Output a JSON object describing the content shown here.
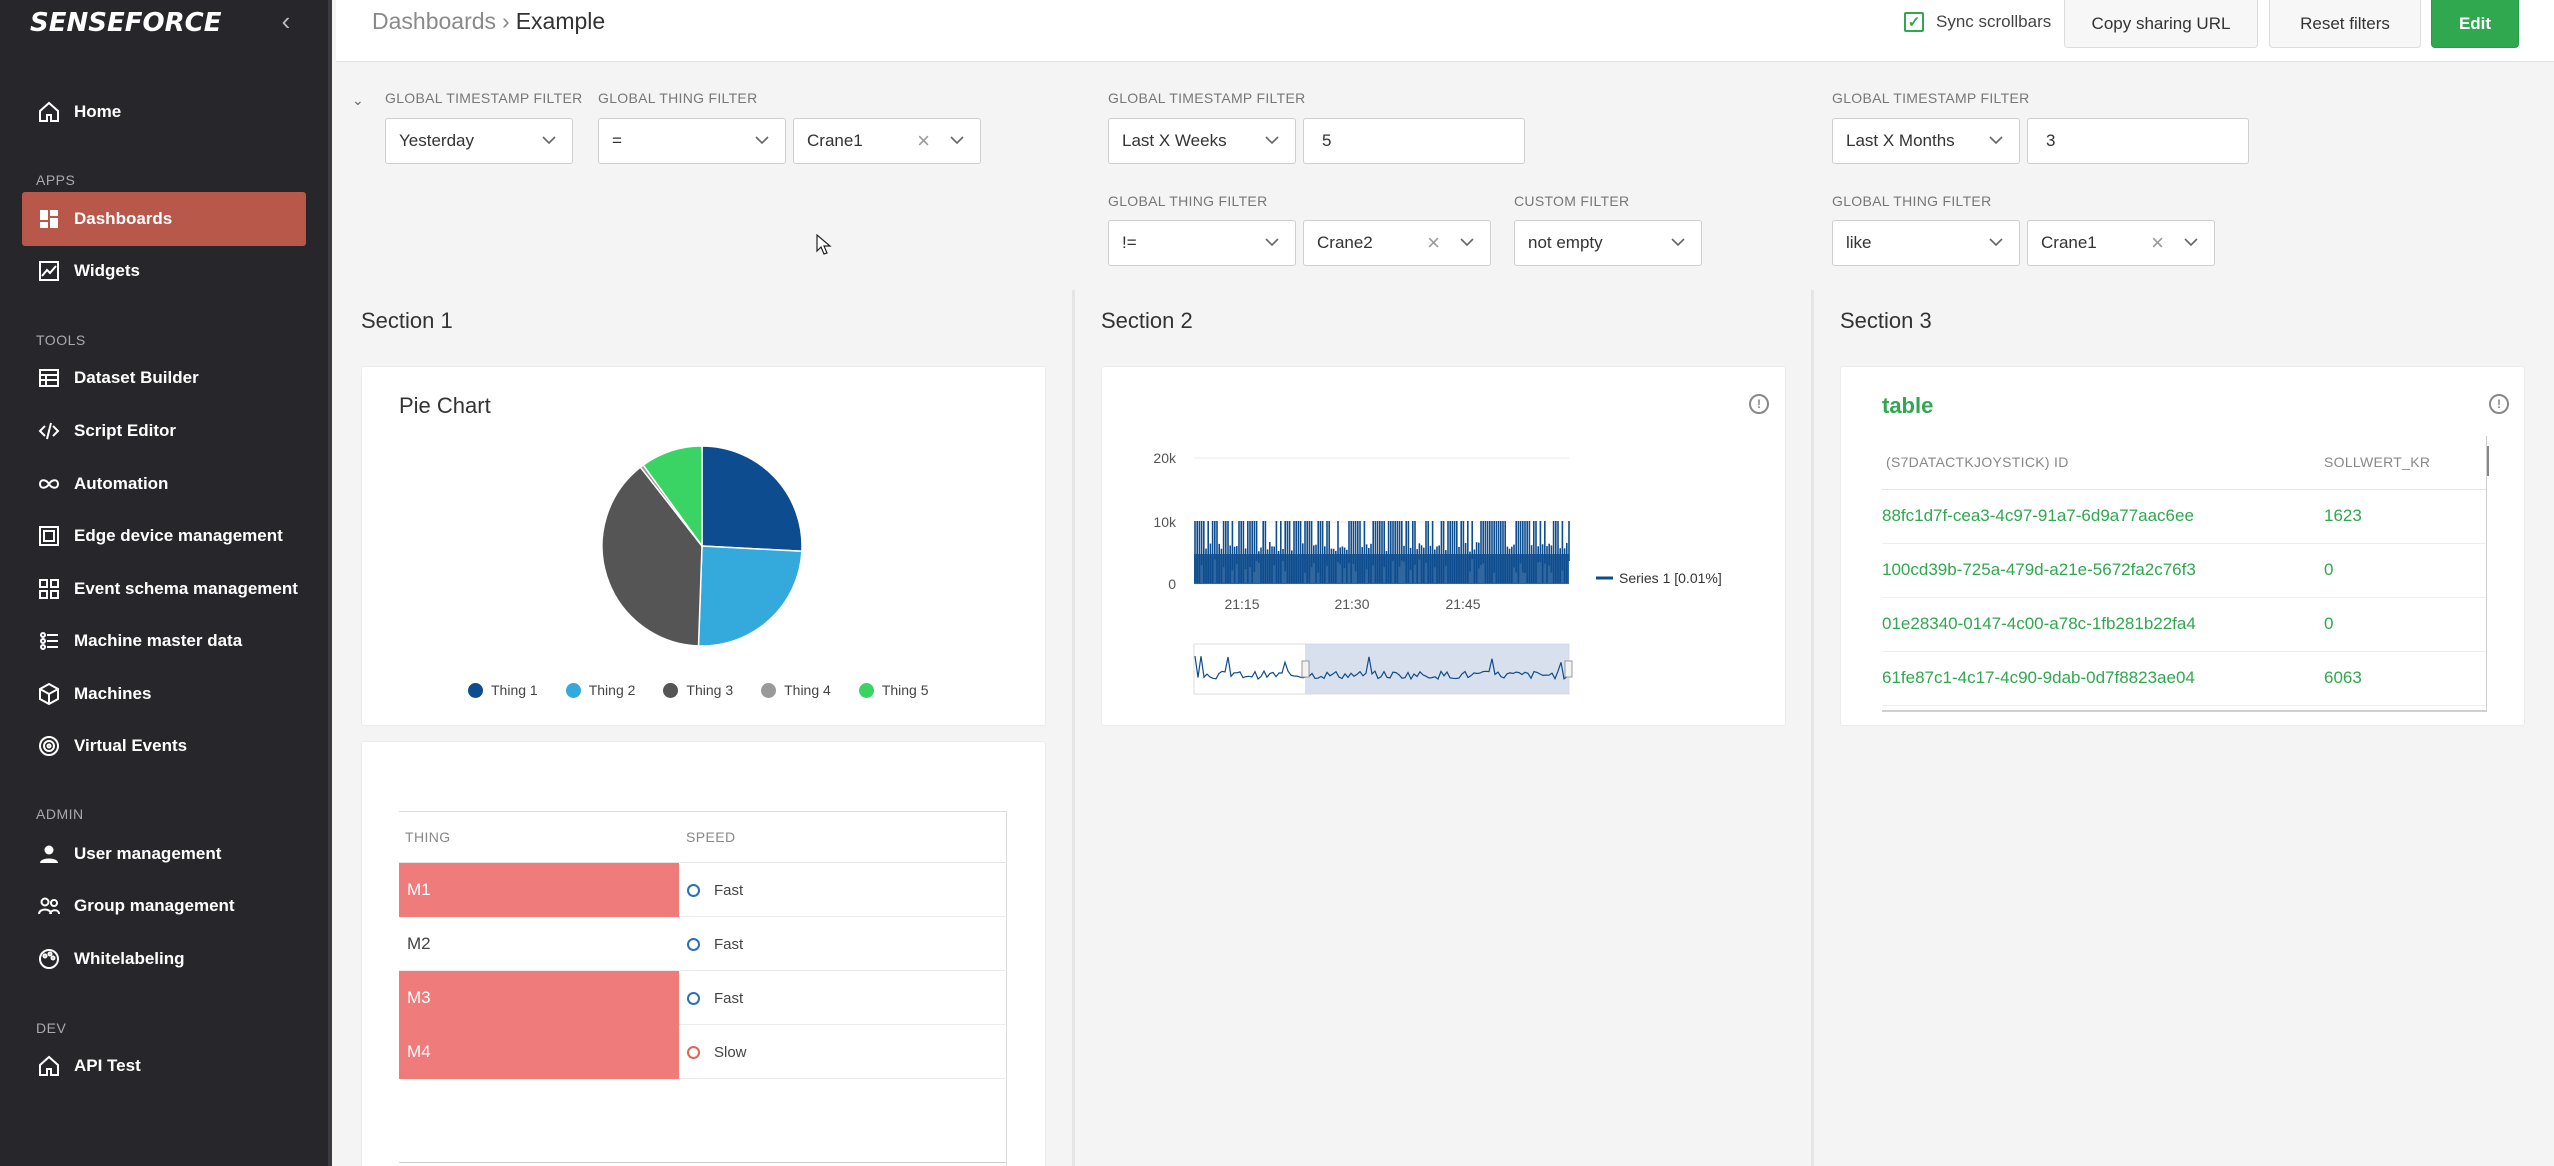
{
  "app": {
    "logo": "SENSEFORCE"
  },
  "sidebar": {
    "sections": {
      "apps": "APPS",
      "tools": "TOOLS",
      "admin": "ADMIN",
      "dev": "DEV"
    },
    "items": [
      {
        "label": "Home",
        "icon": "home-icon"
      },
      {
        "label": "Dashboards",
        "icon": "dashboard-icon",
        "active": true
      },
      {
        "label": "Widgets",
        "icon": "chart-line-icon"
      },
      {
        "label": "Dataset Builder",
        "icon": "database-icon"
      },
      {
        "label": "Script Editor",
        "icon": "code-icon"
      },
      {
        "label": "Automation",
        "icon": "infinity-icon"
      },
      {
        "label": "Edge device management",
        "icon": "device-icon"
      },
      {
        "label": "Event schema management",
        "icon": "schema-icon"
      },
      {
        "label": "Machine master data",
        "icon": "list-icon"
      },
      {
        "label": "Machines",
        "icon": "cube-icon"
      },
      {
        "label": "Virtual Events",
        "icon": "target-icon"
      },
      {
        "label": "User management",
        "icon": "user-icon"
      },
      {
        "label": "Group management",
        "icon": "group-icon"
      },
      {
        "label": "Whitelabeling",
        "icon": "palette-icon"
      },
      {
        "label": "API Test",
        "icon": "home-icon"
      }
    ]
  },
  "header": {
    "breadcrumb_root": "Dashboards",
    "breadcrumb_current": "Example",
    "sync_label": "Sync scrollbars",
    "sync_checked": true,
    "copy_url": "Copy sharing URL",
    "reset_filters": "Reset filters",
    "edit": "Edit"
  },
  "filters": {
    "f1": {
      "label": "GLOBAL TIMESTAMP FILTER",
      "value": "Yesterday"
    },
    "f2": {
      "label": "GLOBAL THING FILTER",
      "op": "=",
      "value": "Crane1"
    },
    "f3": {
      "label": "GLOBAL TIMESTAMP FILTER",
      "value": "Last X Weeks",
      "count": "5"
    },
    "f4": {
      "label": "GLOBAL TIMESTAMP FILTER",
      "value": "Last X Months",
      "count": "3"
    },
    "f5": {
      "label": "GLOBAL THING FILTER",
      "op": "!=",
      "value": "Crane2"
    },
    "f6": {
      "label": "CUSTOM FILTER",
      "value": "not empty"
    },
    "f7": {
      "label": "GLOBAL THING FILTER",
      "op": "like",
      "value": "Crane1"
    }
  },
  "sections": {
    "s1": "Section 1",
    "s2": "Section 2",
    "s3": "Section 3"
  },
  "pie": {
    "title": "Pie Chart",
    "legend": [
      "Thing 1",
      "Thing 2",
      "Thing 3",
      "Thing 4",
      "Thing 5"
    ],
    "colors": [
      "#0d4c8e",
      "#33a9dc",
      "#555555",
      "#9a9a9a",
      "#3ad465"
    ]
  },
  "speed_table": {
    "col_thing": "THING",
    "col_speed": "SPEED",
    "rows": [
      {
        "thing": "M1",
        "speed": "Fast",
        "highlight": true
      },
      {
        "thing": "M2",
        "speed": "Fast",
        "highlight": false
      },
      {
        "thing": "M3",
        "speed": "Fast",
        "highlight": true
      },
      {
        "thing": "M4",
        "speed": "Slow",
        "highlight": true
      }
    ]
  },
  "timeseries": {
    "y_ticks": [
      "20k",
      "10k",
      "0"
    ],
    "x_ticks": [
      "21:15",
      "21:30",
      "21:45"
    ],
    "legend": "Series 1 [0.01%]",
    "color": "#0d4c8e"
  },
  "data_table": {
    "title": "table",
    "col_id": "(S7DATACTKJOYSTICK) ID",
    "col_val": "SOLLWERT_KR",
    "rows": [
      {
        "id": "88fc1d7f-cea3-4c97-91a7-6d9a77aac6ee",
        "val": "1623"
      },
      {
        "id": "100cd39b-725a-479d-a21e-5672fa2c76f3",
        "val": "0"
      },
      {
        "id": "01e28340-0147-4c00-a78c-1fb281b22fa4",
        "val": "0"
      },
      {
        "id": "61fe87c1-4c17-4c90-9dab-0d7f8823ae04",
        "val": "6063"
      }
    ]
  }
}
